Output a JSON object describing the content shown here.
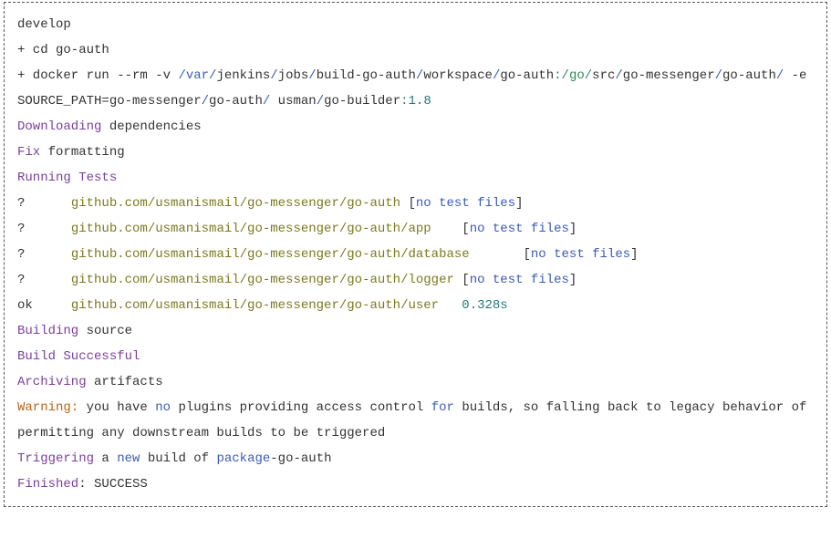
{
  "lines": [
    [
      {
        "c": "plain",
        "t": "develop"
      }
    ],
    [
      {
        "c": "plain",
        "t": "+ cd go-auth"
      }
    ],
    [
      {
        "c": "plain",
        "t": "+ docker run --rm -v "
      },
      {
        "c": "path",
        "t": "/var/"
      },
      {
        "c": "plain",
        "t": "jenkins"
      },
      {
        "c": "path",
        "t": "/"
      },
      {
        "c": "plain",
        "t": "jobs"
      },
      {
        "c": "path",
        "t": "/"
      },
      {
        "c": "plain",
        "t": "build-go-auth"
      },
      {
        "c": "path",
        "t": "/"
      },
      {
        "c": "plain",
        "t": "workspace"
      },
      {
        "c": "path",
        "t": "/"
      },
      {
        "c": "plain",
        "t": "go-auth"
      },
      {
        "c": "green",
        "t": ":/go/"
      },
      {
        "c": "plain",
        "t": "src"
      },
      {
        "c": "path",
        "t": "/"
      },
      {
        "c": "plain",
        "t": "go-messenger"
      },
      {
        "c": "path",
        "t": "/"
      },
      {
        "c": "plain",
        "t": "go-auth"
      },
      {
        "c": "path",
        "t": "/"
      },
      {
        "c": "plain",
        "t": " -e SOURCE_PATH=go-messenger"
      },
      {
        "c": "path",
        "t": "/"
      },
      {
        "c": "plain",
        "t": "go-auth"
      },
      {
        "c": "path",
        "t": "/"
      },
      {
        "c": "plain",
        "t": " usman"
      },
      {
        "c": "path",
        "t": "/"
      },
      {
        "c": "plain",
        "t": "go-builder"
      },
      {
        "c": "green",
        "t": ":"
      },
      {
        "c": "number",
        "t": "1.8"
      }
    ],
    [
      {
        "c": "keyword",
        "t": "Downloading"
      },
      {
        "c": "plain",
        "t": " dependencies"
      }
    ],
    [
      {
        "c": "keyword",
        "t": "Fix"
      },
      {
        "c": "plain",
        "t": " formatting"
      }
    ],
    [
      {
        "c": "keyword",
        "t": "Running Tests"
      }
    ],
    [
      {
        "c": "plain",
        "t": "?      "
      },
      {
        "c": "olive",
        "t": "github.com/usmanismail/go-messenger/go-auth"
      },
      {
        "c": "plain",
        "t": " ["
      },
      {
        "c": "path",
        "t": "no test files"
      },
      {
        "c": "plain",
        "t": "]"
      }
    ],
    [
      {
        "c": "plain",
        "t": "?      "
      },
      {
        "c": "olive",
        "t": "github.com/usmanismail/go-messenger/go-auth/app"
      },
      {
        "c": "plain",
        "t": "    ["
      },
      {
        "c": "path",
        "t": "no test files"
      },
      {
        "c": "plain",
        "t": "]"
      }
    ],
    [
      {
        "c": "plain",
        "t": "?      "
      },
      {
        "c": "olive",
        "t": "github.com/usmanismail/go-messenger/go-auth/database"
      },
      {
        "c": "plain",
        "t": "       ["
      },
      {
        "c": "path",
        "t": "no test files"
      },
      {
        "c": "plain",
        "t": "]"
      }
    ],
    [
      {
        "c": "plain",
        "t": "?      "
      },
      {
        "c": "olive",
        "t": "github.com/usmanismail/go-messenger/go-auth/logger"
      },
      {
        "c": "plain",
        "t": " ["
      },
      {
        "c": "path",
        "t": "no test files"
      },
      {
        "c": "plain",
        "t": "]"
      }
    ],
    [
      {
        "c": "plain",
        "t": "ok     "
      },
      {
        "c": "olive",
        "t": "github.com/usmanismail/go-messenger/go-auth/user"
      },
      {
        "c": "plain",
        "t": "   "
      },
      {
        "c": "number",
        "t": "0.328s"
      }
    ],
    [
      {
        "c": "keyword",
        "t": "Building"
      },
      {
        "c": "plain",
        "t": " source"
      }
    ],
    [
      {
        "c": "keyword",
        "t": "Build Successful"
      }
    ],
    [
      {
        "c": "keyword",
        "t": "Archiving"
      },
      {
        "c": "plain",
        "t": " artifacts"
      }
    ],
    [
      {
        "c": "orange",
        "t": "Warning:"
      },
      {
        "c": "plain",
        "t": " you have "
      },
      {
        "c": "path",
        "t": "no"
      },
      {
        "c": "plain",
        "t": " plugins providing access control "
      },
      {
        "c": "path",
        "t": "for"
      },
      {
        "c": "plain",
        "t": " builds, so falling back to legacy behavior of permitting any downstream builds to be triggered"
      }
    ],
    [
      {
        "c": "keyword",
        "t": "Triggering"
      },
      {
        "c": "plain",
        "t": " a "
      },
      {
        "c": "path",
        "t": "new"
      },
      {
        "c": "plain",
        "t": " build of "
      },
      {
        "c": "path",
        "t": "package"
      },
      {
        "c": "plain",
        "t": "-go-auth"
      }
    ],
    [
      {
        "c": "keyword",
        "t": "Finished"
      },
      {
        "c": "plain",
        "t": ": SUCCESS"
      }
    ]
  ]
}
